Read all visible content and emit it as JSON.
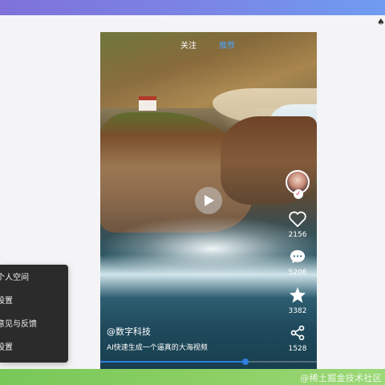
{
  "nav": {
    "follow": "关注",
    "recommend": "推荐"
  },
  "actions": {
    "like_count": "2156",
    "comment_count": "5206",
    "favorite_count": "3382",
    "share_count": "1528"
  },
  "video": {
    "author": "@数字科技",
    "description": "AI快速生成一个逼真的大海视频",
    "progress": 0.67
  },
  "menu": {
    "items": [
      "个人空间",
      "设置",
      "意见与反馈",
      "设置"
    ]
  },
  "footer": {
    "watermark": "@稀土掘金技术社区"
  },
  "colors": {
    "accent": "#2f7fe0",
    "top_band": "#7a86e6",
    "bottom_band": "#8ed066",
    "menu_bg": "#2b2b2b"
  }
}
